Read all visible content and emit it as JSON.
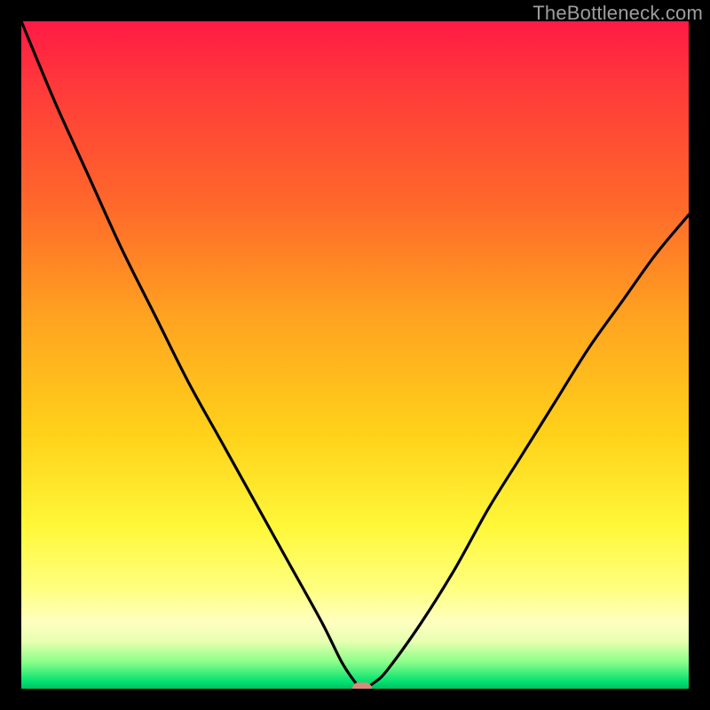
{
  "watermark": "TheBottleneck.com",
  "colors": {
    "frame": "#000000",
    "curve": "#000000",
    "marker": "#d98a7a",
    "gradient_top": "#ff1a45",
    "gradient_bottom": "#00c060"
  },
  "chart_data": {
    "type": "line",
    "title": "",
    "xlabel": "",
    "ylabel": "",
    "xlim": [
      0,
      100
    ],
    "ylim": [
      0,
      100
    ],
    "x": [
      0,
      5,
      10,
      15,
      20,
      25,
      30,
      35,
      40,
      45,
      48,
      50,
      51,
      53,
      55,
      60,
      65,
      70,
      75,
      80,
      85,
      90,
      95,
      100
    ],
    "values": [
      100,
      88,
      77,
      66,
      56,
      46,
      37,
      28,
      19,
      10,
      4,
      1,
      0,
      1,
      3,
      10,
      18,
      27,
      35,
      43,
      51,
      58,
      65,
      71
    ],
    "marker": {
      "x": 51,
      "y": 0
    },
    "note": "V-shaped bottleneck curve over rainbow gradient; y is percent bottleneck, minimum at x≈51."
  }
}
